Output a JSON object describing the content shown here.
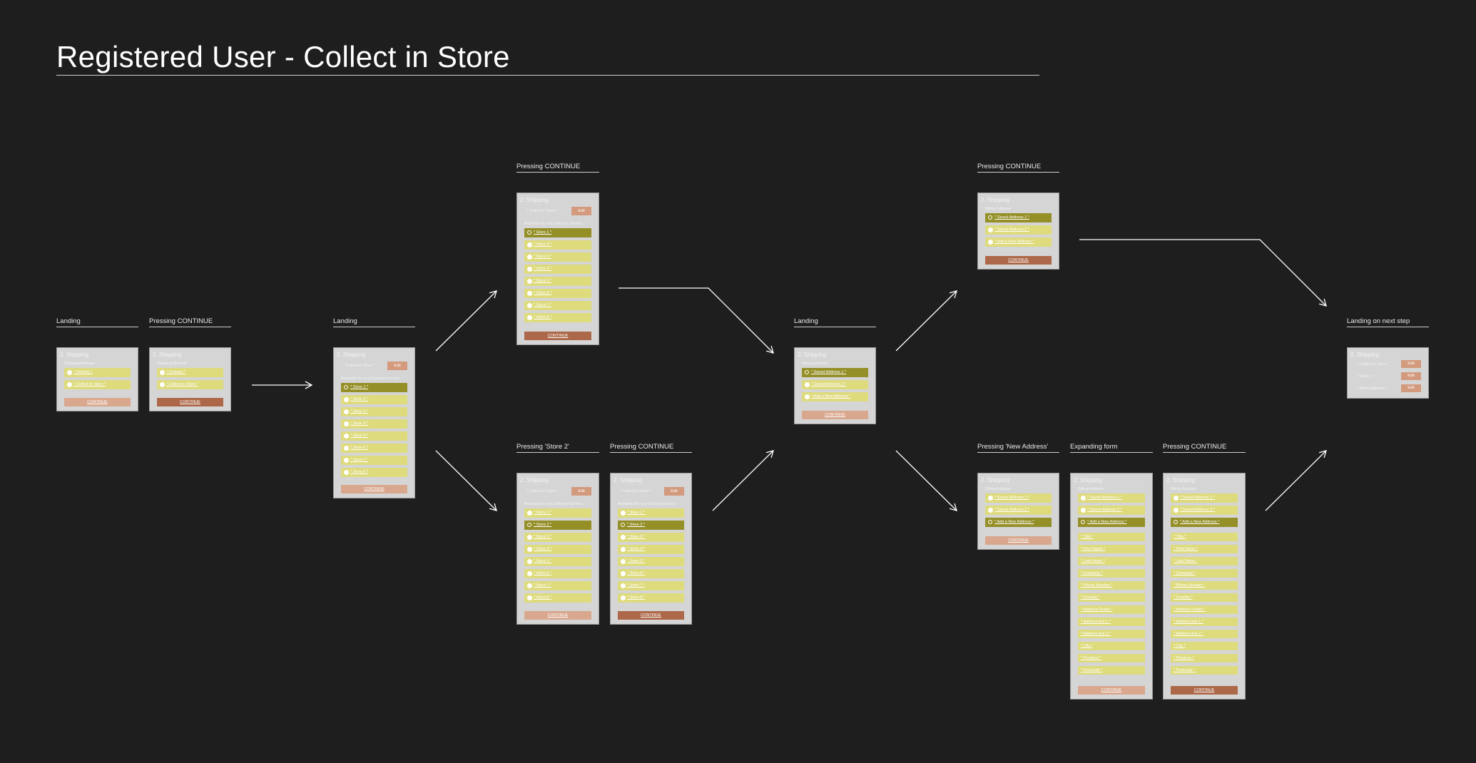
{
  "title": "Registered User - Collect in Store",
  "frames": [
    {
      "id": "f1",
      "label": "Landing",
      "heading": "2. Shipping",
      "sub": "Shipping Address",
      "rows": [
        {
          "t": "* Delivery *",
          "s": false
        },
        {
          "t": "* Collect in Store *",
          "s": false
        }
      ],
      "button": {
        "t": "CONTINUE",
        "style": "light"
      }
    },
    {
      "id": "f2",
      "label": "Pressing CONTINUE",
      "heading": "2. Shipping",
      "sub": "Shipping Method",
      "rows": [
        {
          "t": "* Delivery *",
          "s": false
        },
        {
          "t": "* Collect in Store *",
          "s": false
        }
      ],
      "button": {
        "t": "CONTINUE",
        "style": "dark"
      }
    },
    {
      "id": "f3",
      "label": "Landing",
      "heading": "2. Shipping",
      "summary": "* Collect in Store *",
      "edit": "Edit",
      "sub": "Available for any Delivery Service",
      "rows": [
        {
          "t": "* Store 1 *",
          "s": true
        },
        {
          "t": "* Store 2 *",
          "s": false
        },
        {
          "t": "* Store 3 *",
          "s": false
        },
        {
          "t": "* Store 4 *",
          "s": false
        },
        {
          "t": "* Store 5 *",
          "s": false
        },
        {
          "t": "* Store 6 *",
          "s": false
        },
        {
          "t": "* Store 7 *",
          "s": false
        },
        {
          "t": "* Store 8 *",
          "s": false
        }
      ],
      "button": {
        "t": "CONTINUE",
        "style": "light"
      }
    },
    {
      "id": "f4",
      "label": "Pressing CONTINUE",
      "heading": "2. Shipping",
      "summary": "* Collect in Store *",
      "edit": "Edit",
      "sub": "Available for any Delivery Service",
      "rows": [
        {
          "t": "* Store 1 *",
          "s": true
        },
        {
          "t": "* Store 2 *",
          "s": false
        },
        {
          "t": "* Store 3 *",
          "s": false
        },
        {
          "t": "* Store 4 *",
          "s": false
        },
        {
          "t": "* Store 5 *",
          "s": false
        },
        {
          "t": "* Store 6 *",
          "s": false
        },
        {
          "t": "* Store 7 *",
          "s": false
        },
        {
          "t": "* Store 8 *",
          "s": false
        }
      ],
      "button": {
        "t": "CONTINUE",
        "style": "dark"
      }
    },
    {
      "id": "f5",
      "label": "Pressing 'Store 2'",
      "heading": "2. Shipping",
      "summary": "* Collect in Store *",
      "edit": "Edit",
      "sub": "Available for any Delivery Service",
      "rows": [
        {
          "t": "* Store 1 *",
          "s": false
        },
        {
          "t": "* Store 2 *",
          "s": true
        },
        {
          "t": "* Store 3 *",
          "s": false
        },
        {
          "t": "* Store 4 *",
          "s": false
        },
        {
          "t": "* Store 5 *",
          "s": false
        },
        {
          "t": "* Store 6 *",
          "s": false
        },
        {
          "t": "* Store 7 *",
          "s": false
        },
        {
          "t": "* Store 8 *",
          "s": false
        }
      ],
      "button": {
        "t": "CONTINUE",
        "style": "light"
      }
    },
    {
      "id": "f6",
      "label": "Pressing CONTINUE",
      "heading": "2. Shipping",
      "summary": "* Collect in Store *",
      "edit": "Edit",
      "sub": "Available for any Delivery Service",
      "rows": [
        {
          "t": "* Store 1 *",
          "s": false
        },
        {
          "t": "* Store 2 *",
          "s": true
        },
        {
          "t": "* Store 3 *",
          "s": false
        },
        {
          "t": "* Store 4 *",
          "s": false
        },
        {
          "t": "* Store 5 *",
          "s": false
        },
        {
          "t": "* Store 6 *",
          "s": false
        },
        {
          "t": "* Store 7 *",
          "s": false
        },
        {
          "t": "* Store 8 *",
          "s": false
        }
      ],
      "button": {
        "t": "CONTINUE",
        "style": "dark"
      }
    },
    {
      "id": "f7",
      "label": "Landing",
      "heading": "2. Shipping",
      "sub": "Billing Address",
      "rows": [
        {
          "t": "* Saved Address 1 *",
          "s": true
        },
        {
          "t": "* Saved Address 2 *",
          "s": false
        },
        {
          "t": "* Add a New Address *",
          "s": false
        }
      ],
      "button": {
        "t": "CONTINUE",
        "style": "light"
      }
    },
    {
      "id": "f8",
      "label": "Pressing CONTINUE",
      "heading": "2. Shipping",
      "sub": "Billing Address",
      "rows": [
        {
          "t": "* Saved Address 1 *",
          "s": true
        },
        {
          "t": "* Saved Address 2 *",
          "s": false
        },
        {
          "t": "* Add a New Address *",
          "s": false
        }
      ],
      "button": {
        "t": "CONTINUE",
        "style": "dark"
      }
    },
    {
      "id": "f9",
      "label": "Pressing 'New Address'",
      "heading": "2. Shipping",
      "sub": "Billing Address",
      "rows": [
        {
          "t": "* Saved Address 1 *",
          "s": false
        },
        {
          "t": "* Saved Address 2 *",
          "s": false
        },
        {
          "t": "* Add a New Address *",
          "s": true
        }
      ],
      "button": {
        "t": "CONTINUE",
        "style": "light"
      }
    },
    {
      "id": "f10",
      "label": "Expanding form",
      "heading": "2. Shipping",
      "sub": "Billing Address",
      "rows": [
        {
          "t": "* Saved Address 1 *",
          "s": false
        },
        {
          "t": "* Saved Address 2 *",
          "s": false
        },
        {
          "t": "* Add a New Address *",
          "s": true
        }
      ],
      "fields": [
        "* Title *",
        "* First Name *",
        "* Last Name *",
        "* Company *",
        "* Phone Number *",
        "* Country *",
        "* Address Finder *",
        "* Address line 1 *",
        "* Address line 2 *",
        "* City *",
        "* Province *",
        "* Postcode *"
      ],
      "button": {
        "t": "CONTINUE",
        "style": "light"
      }
    },
    {
      "id": "f11",
      "label": "Pressing CONTINUE",
      "heading": "2. Shipping",
      "sub": "Billing Address",
      "rows": [
        {
          "t": "* Saved Address 1 *",
          "s": false
        },
        {
          "t": "* Saved Address 2 *",
          "s": false
        },
        {
          "t": "* Add a New Address *",
          "s": true
        }
      ],
      "fields": [
        "* Title *",
        "* First Name *",
        "* Last Name *",
        "* Company *",
        "* Phone Number *",
        "* Country *",
        "* Address Finder *",
        "* Address line 1 *",
        "* Address line 2 *",
        "* City *",
        "* Province *",
        "* Postcode *"
      ],
      "button": {
        "t": "CONTINUE",
        "style": "dark"
      }
    },
    {
      "id": "f12",
      "label": "Landing on next step",
      "heading": "2. Shipping",
      "summaries": [
        {
          "t": "* Collect in Store *",
          "e": "Edit"
        },
        {
          "t": "* Store 1 *",
          "e": "Edit"
        },
        {
          "t": "* Billing Address *",
          "e": "Edit"
        }
      ]
    }
  ]
}
